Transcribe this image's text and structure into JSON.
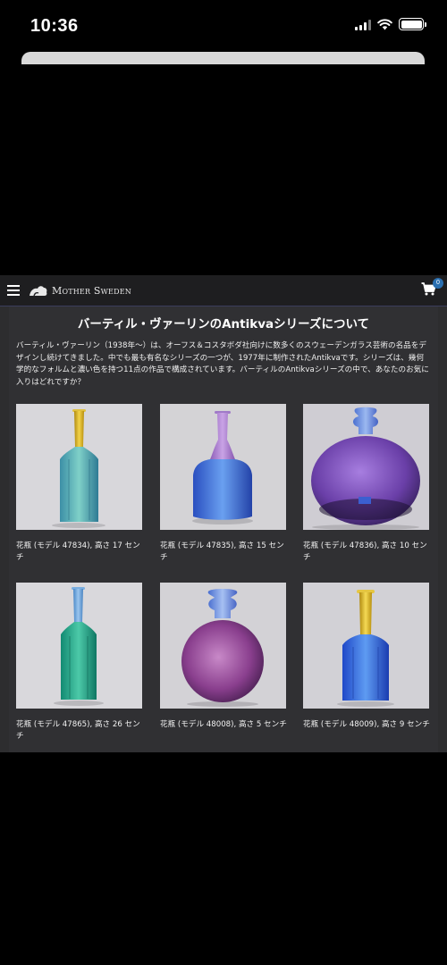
{
  "status_bar": {
    "time": "10:36"
  },
  "header": {
    "logo_text": "Mother Sweden",
    "cart_count": "0"
  },
  "main": {
    "title": "バーティル・ヴァーリンのAntikvaシリーズについて",
    "description": "バーティル・ヴァーリン（1938年〜）は、オーフス＆コスタボダ社向けに数多くのスウェーデンガラス芸術の名品をデザインし続けてきました。中でも最も有名なシリーズの一つが、1977年に制作されたAntikvaです。シリーズは、幾何学的なフォルムと濃い色を持つ11点の作品で構成されています。バーティルのAntikvaシリーズの中で、あなたのお気に入りはどれですか？"
  },
  "products": [
    {
      "caption": "花瓶 (モデル 47834), 高さ 17 センチ",
      "icon": "tall-hexagonal-bottle-vase-teal-yellow-neck"
    },
    {
      "caption": "花瓶 (モデル 47835), 高さ 15 センチ",
      "icon": "bell-bottle-vase-blue-purple-neck"
    },
    {
      "caption": "花瓶 (モデル 47836), 高さ 10 センチ",
      "icon": "round-bowl-vase-purple"
    },
    {
      "caption": "花瓶 (モデル 47865), 高さ 26 センチ",
      "icon": "tall-hexagonal-bottle-vase-green-blue-neck"
    },
    {
      "caption": "花瓶 (モデル 48008), 高さ 5 センチ",
      "icon": "round-bulb-vase-purple-blue-neck"
    },
    {
      "caption": "花瓶 (モデル 48009), 高さ 9 センチ",
      "icon": "hexagonal-bottle-vase-blue-yellow-neck"
    }
  ],
  "colors": {
    "page_bg": "#2d2d2f",
    "header_bg": "#1e1e20",
    "badge": "#2a6fb0"
  }
}
